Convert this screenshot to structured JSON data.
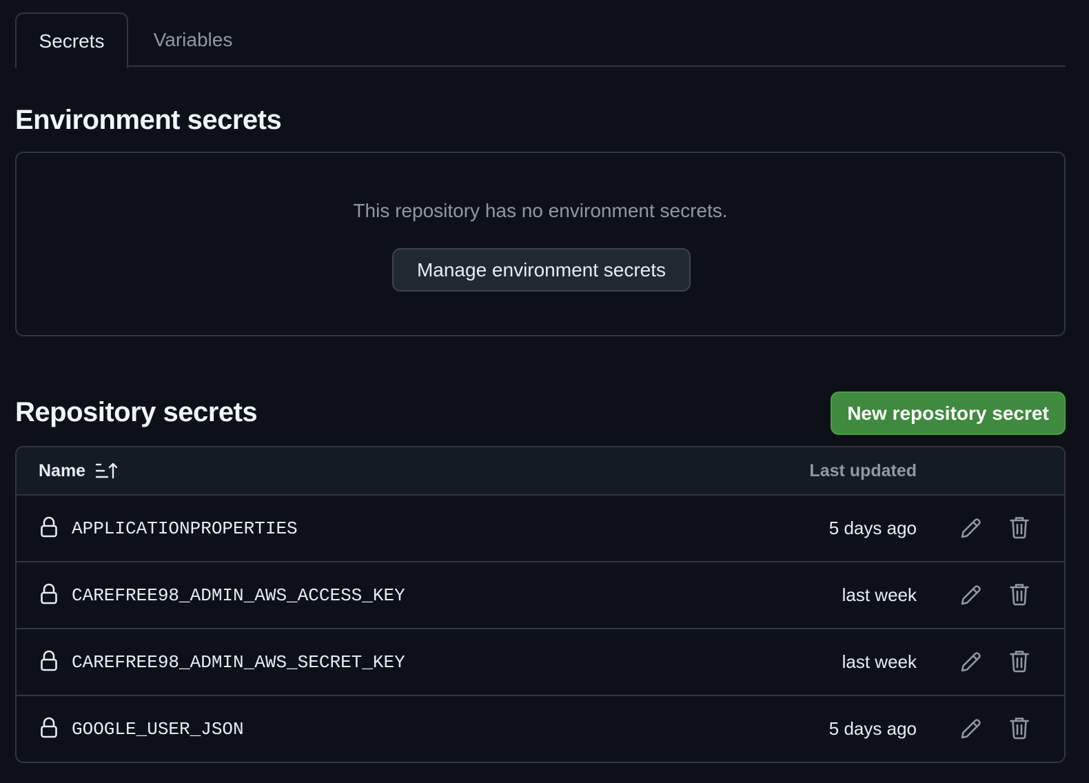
{
  "tabs": [
    {
      "label": "Secrets",
      "active": true
    },
    {
      "label": "Variables",
      "active": false
    }
  ],
  "environment": {
    "heading": "Environment secrets",
    "empty_text": "This repository has no environment secrets.",
    "manage_button": "Manage environment secrets"
  },
  "repository": {
    "heading": "Repository secrets",
    "new_button": "New repository secret",
    "table": {
      "col_name": "Name",
      "col_updated": "Last updated",
      "sort_icon": "sort-ascending-icon",
      "rows": [
        {
          "name": "APPLICATIONPROPERTIES",
          "updated": "5 days ago"
        },
        {
          "name": "CAREFREE98_ADMIN_AWS_ACCESS_KEY",
          "updated": "last week"
        },
        {
          "name": "CAREFREE98_ADMIN_AWS_SECRET_KEY",
          "updated": "last week"
        },
        {
          "name": "GOOGLE_USER_JSON",
          "updated": "5 days ago"
        }
      ]
    }
  },
  "icons": {
    "row_lead": "lock-icon",
    "edit": "pencil-icon",
    "delete": "trash-icon"
  },
  "colors": {
    "background": "#0d1117",
    "border": "#30363d",
    "primary_button": "#3f8a3f",
    "muted_text": "#9198a1"
  }
}
